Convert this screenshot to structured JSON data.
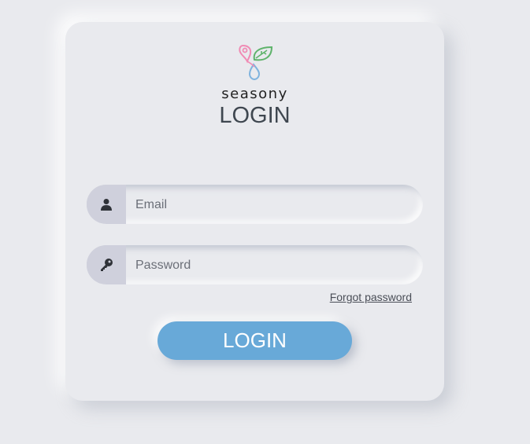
{
  "brand": {
    "name": "seasony",
    "logo_icon": "seasony-logo-icon"
  },
  "page": {
    "title": "LOGIN"
  },
  "form": {
    "email": {
      "placeholder": "Email",
      "value": "",
      "icon": "user-icon"
    },
    "password": {
      "placeholder": "Password",
      "value": "",
      "icon": "key-icon"
    },
    "forgot_label": "Forgot password",
    "submit_label": "LOGIN"
  },
  "colors": {
    "background": "#e9eaee",
    "button": "#68a9d8",
    "icon_bg": "#cfd0dc",
    "logo_pink": "#f08bb4",
    "logo_green": "#5fb36b",
    "logo_blue": "#7fb3de"
  }
}
